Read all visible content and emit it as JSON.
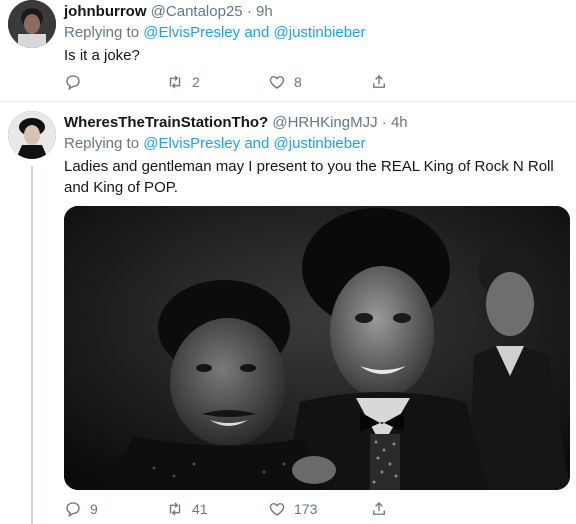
{
  "tweets": [
    {
      "name": "johnburrow",
      "handle": "@Cantalop25",
      "dot": "·",
      "time": "9h",
      "replying_prefix": "Replying to",
      "replying_to_1": "@ElvisPresley",
      "replying_and": "and",
      "replying_to_2": "@justinbieber",
      "text": "Is it a joke?",
      "replies": "",
      "retweets": "2",
      "likes": "8"
    },
    {
      "name": "WheresTheTrainStationTho?",
      "handle": "@HRHKingMJJ",
      "dot": "·",
      "time": "4h",
      "replying_prefix": "Replying to",
      "replying_to_1": "@ElvisPresley",
      "replying_and": "and",
      "replying_to_2": "@justinbieber",
      "text": "Ladies and gentleman may I present to you the REAL King of Rock N Roll and King of POP.",
      "replies": "9",
      "retweets": "41",
      "likes": "173"
    }
  ],
  "icons": [
    "reply-icon",
    "retweet-icon",
    "like-icon",
    "share-icon"
  ],
  "colors": {
    "link": "#1da1f2",
    "muted": "#657786",
    "separator": "#e6ecf0"
  }
}
